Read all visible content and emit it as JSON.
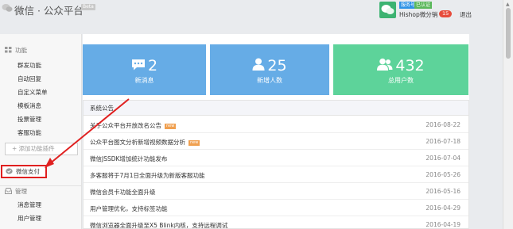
{
  "header": {
    "brand": "微信 · 公众平台",
    "beta_tag": "Beta",
    "account_tag_1": "服务号",
    "account_tag_2": "已认证",
    "account_name": "Hishop微分销",
    "notification_count": "15",
    "logout_label": "退出"
  },
  "sidebar": {
    "function_title": "功能",
    "function_items": [
      "群发功能",
      "自动回复",
      "自定义菜单",
      "模板消息",
      "投票管理",
      "客服功能"
    ],
    "add_plugin_label": "+ 添加功能插件",
    "wechat_pay_label": "微信支付",
    "manage_title": "管理",
    "manage_items": [
      "消息管理",
      "用户管理"
    ]
  },
  "stats": [
    {
      "value": "2",
      "label": "新消息",
      "icon": "message-icon"
    },
    {
      "value": "25",
      "label": "新增人数",
      "icon": "user-icon"
    },
    {
      "value": "432",
      "label": "总用户数",
      "icon": "users-icon"
    }
  ],
  "announcements": {
    "title": "系统公告",
    "new_tag": "new",
    "items": [
      {
        "title": "关于公众平台开放改名公告",
        "date": "2016-08-22",
        "is_new": true
      },
      {
        "title": "公众平台图文分析新增视频数据分析",
        "date": "2016-07-18",
        "is_new": true
      },
      {
        "title": "微信JSSDK增加统计功能发布",
        "date": "2016-07-04",
        "is_new": false
      },
      {
        "title": "多客服将于7月1日全面升级为新版客服功能",
        "date": "2016-05-26",
        "is_new": false
      },
      {
        "title": "微信会员卡功能全面升级",
        "date": "2016-05-16",
        "is_new": false
      },
      {
        "title": "用户管理优化，支持标签功能",
        "date": "2016-04-29",
        "is_new": false
      },
      {
        "title": "微信浏览器全面升级至X5 Blink内核，支持远程调试",
        "date": "2016-04-19",
        "is_new": false
      }
    ]
  },
  "colors": {
    "stat_blue": "#66ace6",
    "stat_green": "#5dd39a",
    "highlight_red": "#e02020",
    "badge_red": "#e74c3c"
  }
}
